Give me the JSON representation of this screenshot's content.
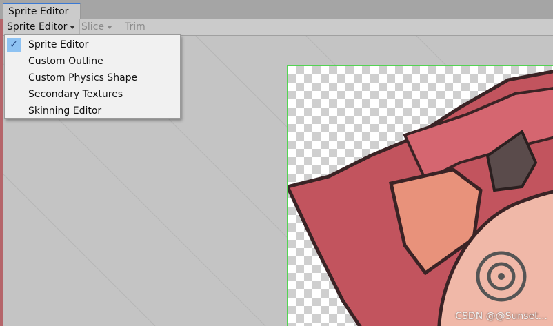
{
  "window": {
    "tab_title": "Sprite Editor"
  },
  "toolbar": {
    "mode_dropdown": "Sprite Editor",
    "slice_label": "Slice",
    "trim_label": "Trim"
  },
  "menu": {
    "items": [
      {
        "label": "Sprite Editor",
        "checked": true
      },
      {
        "label": "Custom Outline",
        "checked": false
      },
      {
        "label": "Custom Physics Shape",
        "checked": false
      },
      {
        "label": "Secondary Textures",
        "checked": false
      },
      {
        "label": "Skinning Editor",
        "checked": false
      }
    ]
  },
  "watermark": "CSDN @@Sunset...",
  "colors": {
    "selection_highlight": "#8ec2f2",
    "sprite_border": "#53d353",
    "tab_accent": "#3a79d4"
  }
}
